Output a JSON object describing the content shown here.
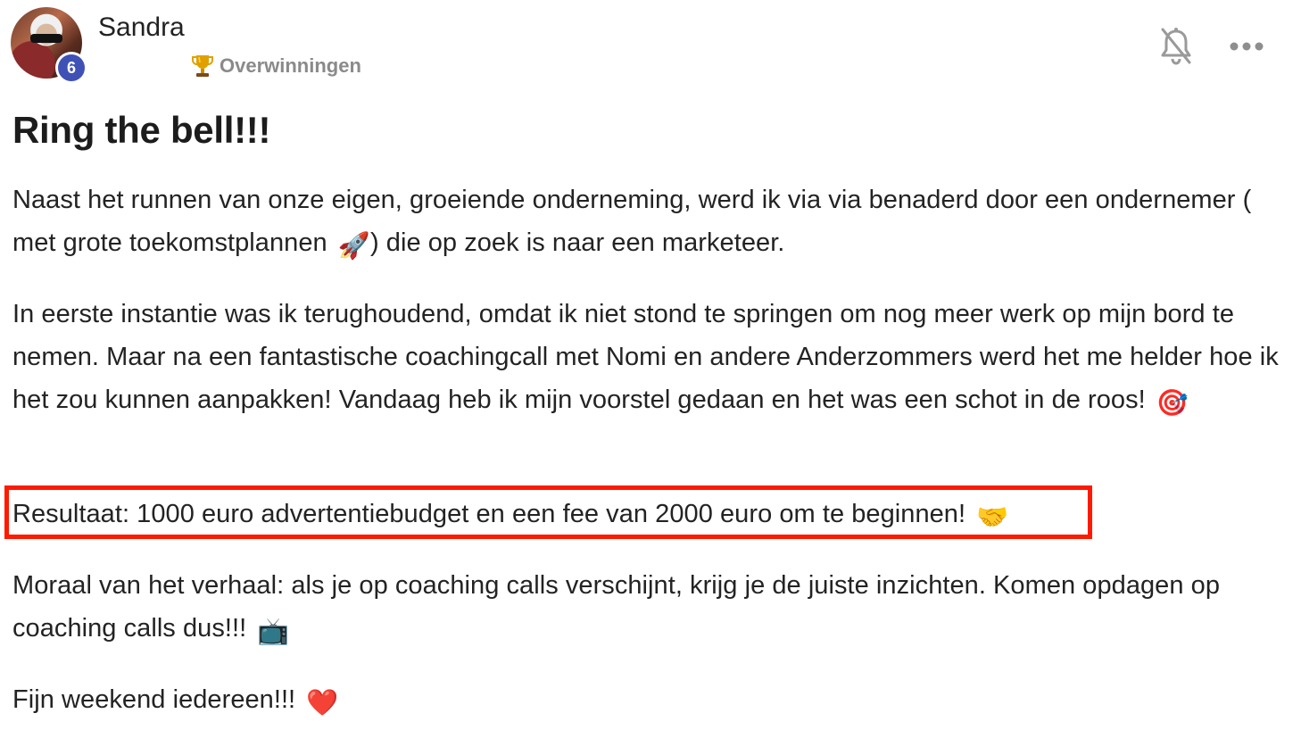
{
  "author": {
    "name": "Sandra",
    "level": "6"
  },
  "category": {
    "label": "Overwinningen",
    "icon": "trophy-icon"
  },
  "actions": {
    "bell_icon": "bell-off-icon",
    "more_icon": "more-horizontal-icon"
  },
  "post": {
    "title": "Ring the bell!!!",
    "p1_text": "Naast het runnen van onze eigen, groeiende onderneming, werd ik via via benaderd door een ondernemer ( met grote toekomstplannen ",
    "p1_emoji": "🚀",
    "p1_end": ") die op zoek is naar een marketeer.",
    "p2_text": "In eerste instantie was ik terughoudend, omdat ik niet stond te springen om nog meer werk op mijn bord te nemen. Maar na een fantastische coachingcall met Nomi en andere Anderzommers werd het me helder hoe ik het zou kunnen aanpakken! Vandaag heb ik mijn voorstel gedaan en het was een schot in de roos!",
    "p2_emoji": "🎯",
    "p3_text": "Resultaat: 1000 euro advertentiebudget en een fee van 2000 euro om te beginnen!",
    "p3_emoji": "🤝",
    "p4_text": "Moraal van het verhaal: als je op coaching calls verschijnt, krijg je de juiste inzichten. Komen opdagen op coaching calls dus!!!",
    "p4_emoji": "📺",
    "p5_text": "Fijn weekend iedereen!!!",
    "p5_emoji": "❤️"
  },
  "colors": {
    "badge": "#3f51b5",
    "highlight": "#ff1a00",
    "muted": "#8a8a8a"
  }
}
